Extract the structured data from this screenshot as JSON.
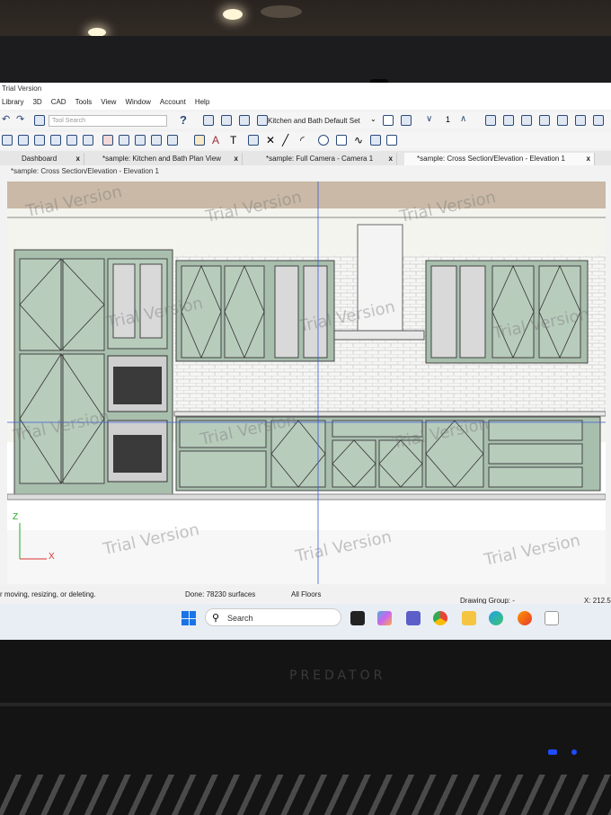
{
  "app": {
    "title": "Trial Version"
  },
  "menu": [
    "Library",
    "3D",
    "CAD",
    "Tools",
    "View",
    "Window",
    "Account",
    "Help"
  ],
  "toolbar": {
    "tool_search_placeholder": "Tool Search",
    "default_set": "Kitchen and Bath Default Set",
    "counter": "1"
  },
  "tabs": [
    {
      "label": "Dashboard",
      "close": "x"
    },
    {
      "label": "*sample: Kitchen and Bath Plan View",
      "close": "x"
    },
    {
      "label": "*sample: Full Camera - Camera 1",
      "close": "x"
    },
    {
      "label": "*sample: Cross Section/Elevation - Elevation 1",
      "close": "x"
    }
  ],
  "view": {
    "subtitle": "*sample: Cross Section/Elevation - Elevation 1",
    "watermark": "Trial Version",
    "axis_x": "X",
    "axis_z": "Z"
  },
  "status": {
    "hint": "r moving, resizing, or deleting.",
    "done": "Done: 78230 surfaces",
    "floors": "All Floors",
    "drawing_group": "Drawing Group: -",
    "coords": "X: 212.5"
  },
  "taskbar": {
    "search": "Search"
  },
  "hardware": {
    "brand": "PREDATOR"
  }
}
